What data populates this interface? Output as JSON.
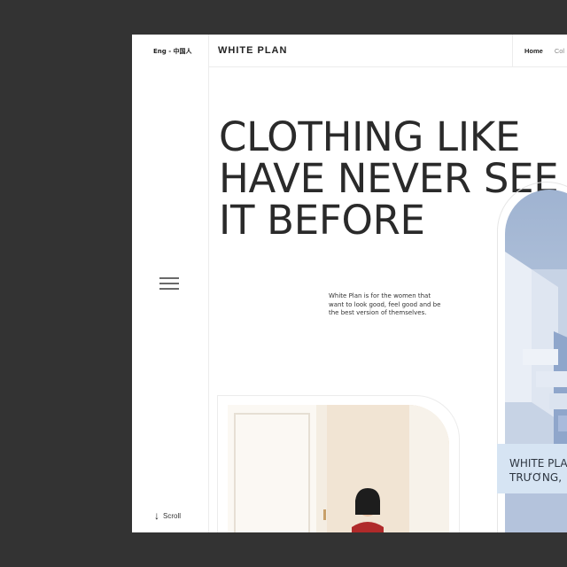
{
  "language": "Eng - 中国人",
  "brand": "WHITE PLAN",
  "nav": [
    "Home",
    "Col"
  ],
  "hero": [
    "CLOTHING LIKE",
    "HAVE NEVER SEE",
    "IT BEFORE"
  ],
  "intro": "White Plan is for the women that want to look good, feel good and be the best version of themselves.",
  "caption": [
    "WHITE PLA",
    "TRƯƠNG,"
  ],
  "scroll_label": "Scroll",
  "colors": {
    "background": "#333333",
    "page": "#ffffff",
    "text": "#2a2a2a",
    "caption_bg": "#d6e4f3"
  }
}
